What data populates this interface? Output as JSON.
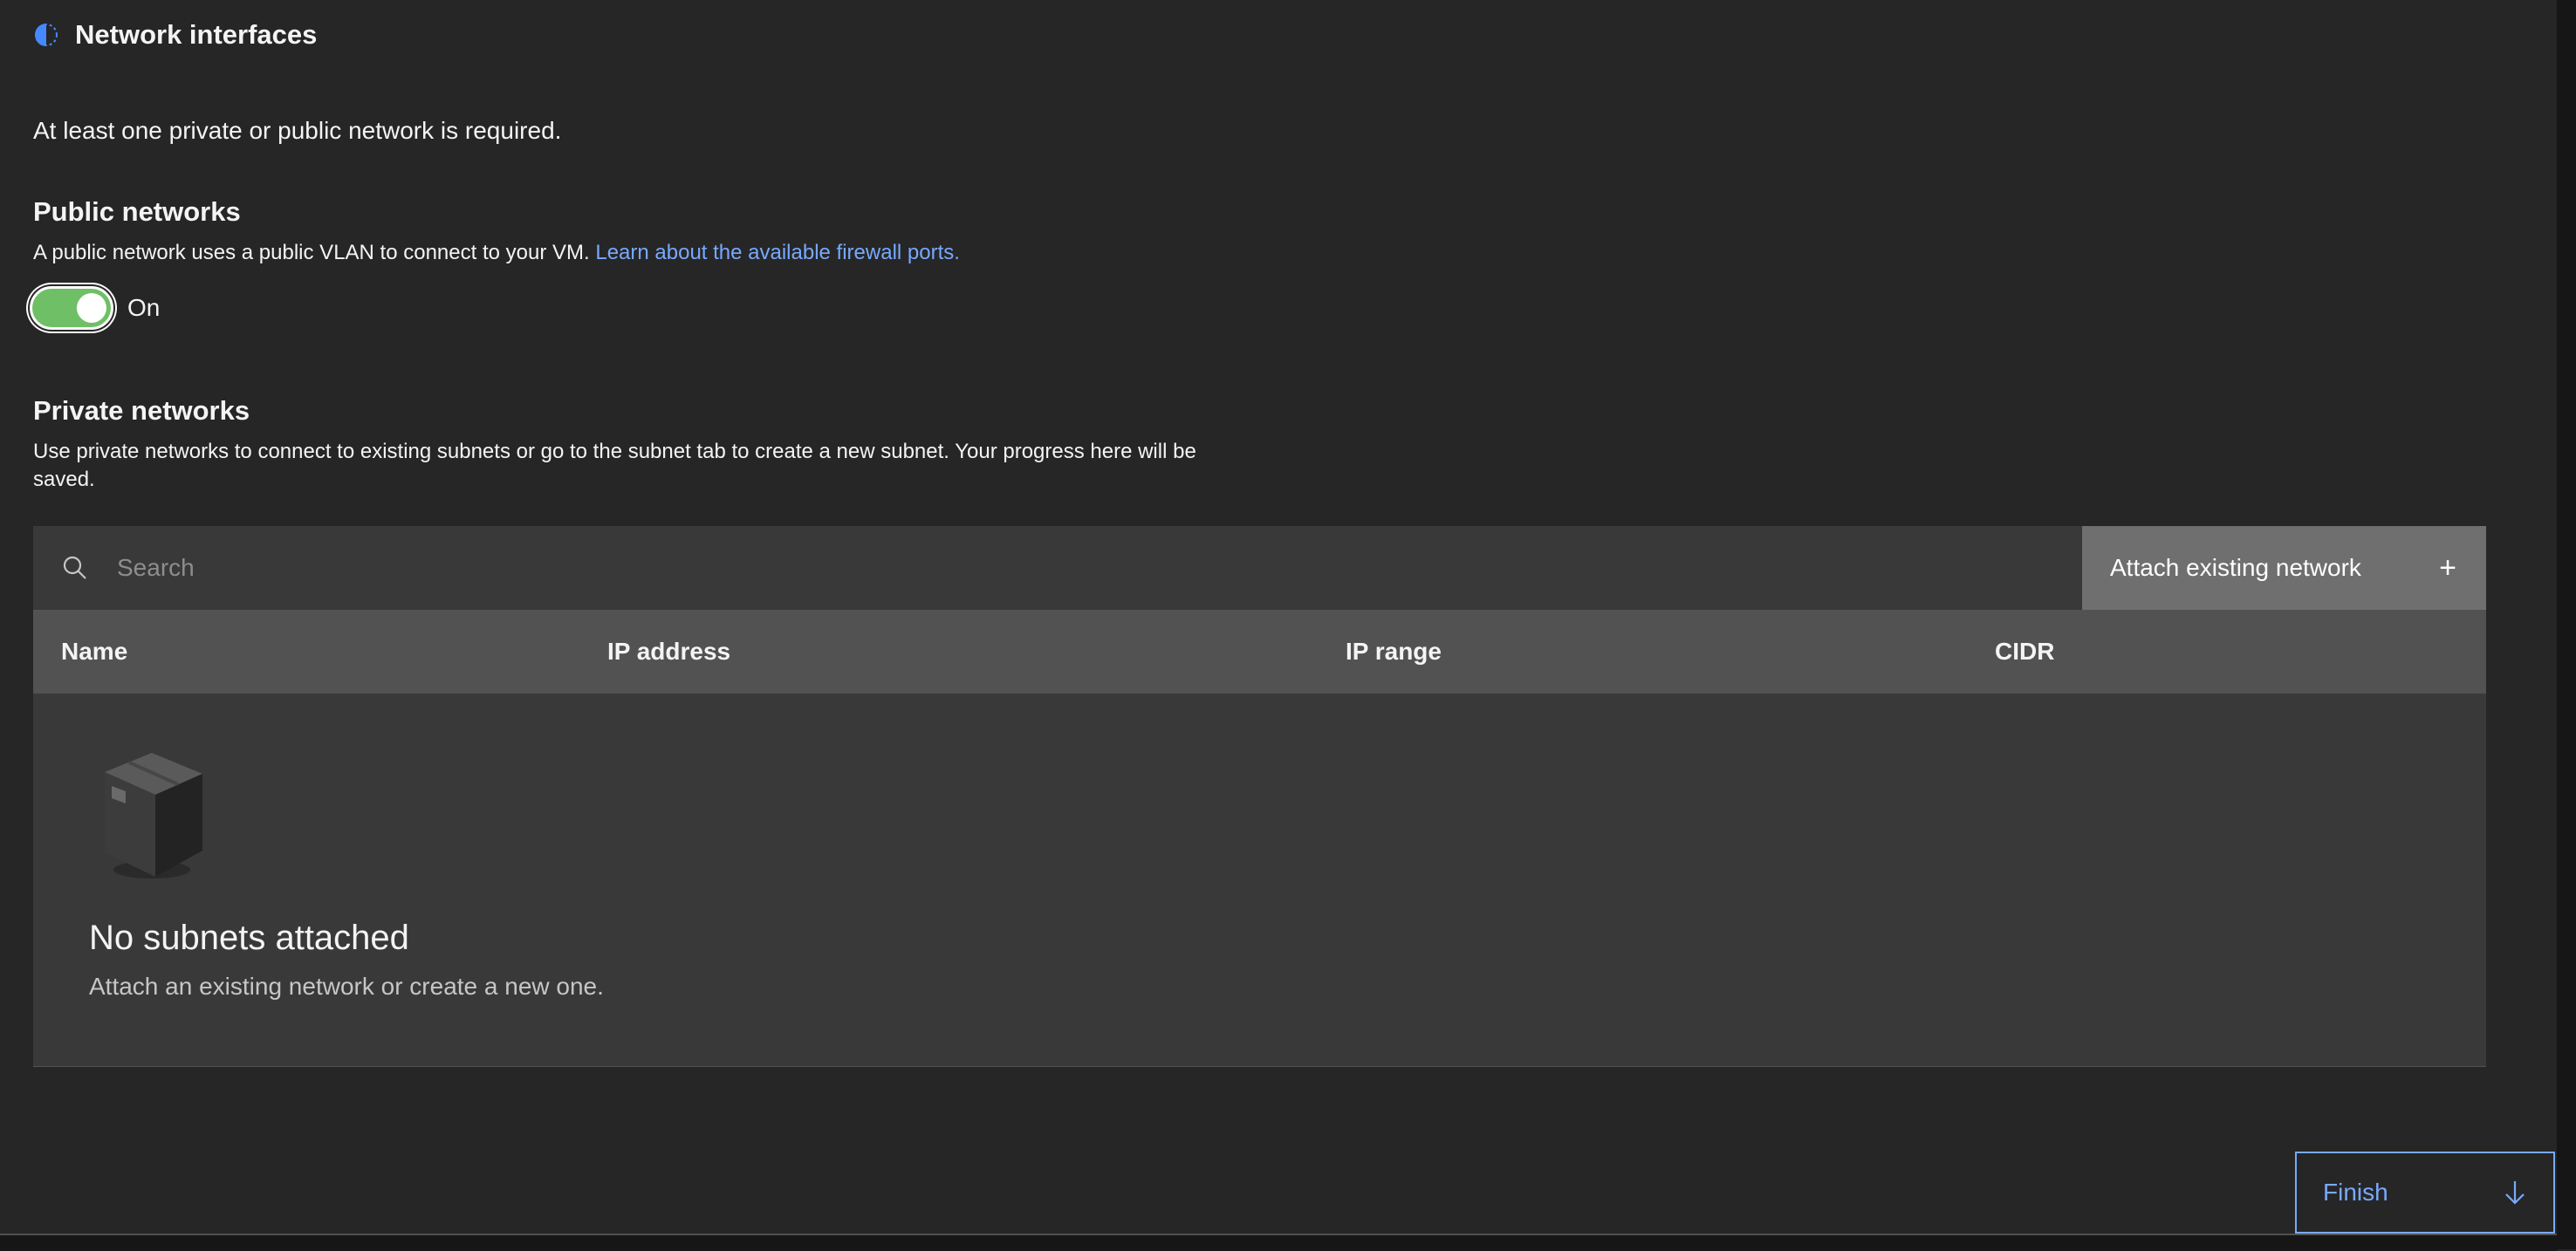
{
  "header": {
    "title": "Network interfaces"
  },
  "intro": "At least one private or public network is required.",
  "public_networks": {
    "heading": "Public networks",
    "description": "A public network uses a public VLAN to connect to your VM.",
    "link": "Learn about the available firewall ports.",
    "toggle_state": "On"
  },
  "private_networks": {
    "heading": "Private networks",
    "description": "Use private networks to connect to existing subnets or go to the subnet tab to create a new subnet. Your progress here will be saved."
  },
  "table": {
    "search_placeholder": "Search",
    "attach_button": "Attach existing network",
    "columns": [
      "Name",
      "IP address",
      "IP range",
      "CIDR"
    ],
    "empty_title": "No subnets attached",
    "empty_description": "Attach an existing network or create a new one."
  },
  "footer": {
    "finish_label": "Finish"
  },
  "colors": {
    "accent": "#78a9ff",
    "toggle_on": "#6fbf67",
    "background": "#262626"
  }
}
